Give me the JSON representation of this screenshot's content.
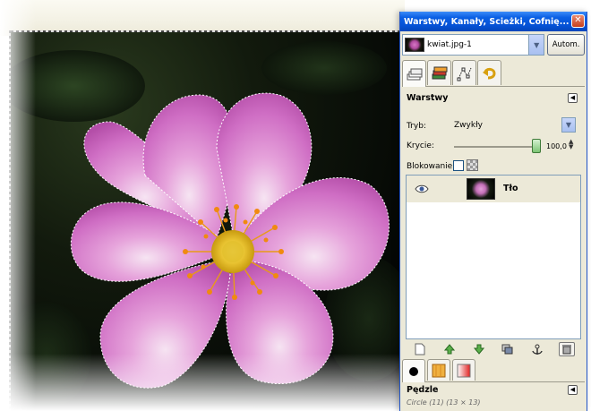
{
  "dock": {
    "title": "Warstwy, Kanały, Ścieżki, Cofnię...",
    "close_icon": "close-icon",
    "image_selector": {
      "value": "kwiat.jpg-1"
    },
    "auto_button": "Autom.",
    "tabs": [
      "layers-tab-icon",
      "channels-tab-icon",
      "paths-tab-icon",
      "undo-tab-icon"
    ]
  },
  "layers_panel": {
    "title": "Warstwy",
    "mode_label": "Tryb:",
    "mode_value": "Zwykły",
    "opacity_label": "Krycie:",
    "opacity_value": "100,0",
    "opacity_level": 1.0,
    "lock_label": "Blokowanie:",
    "layers": [
      {
        "name": "Tło",
        "visible": true
      }
    ],
    "tools": [
      "new-layer-icon",
      "raise-layer-icon",
      "lower-layer-icon",
      "duplicate-layer-icon",
      "anchor-layer-icon",
      "delete-layer-icon"
    ]
  },
  "brushes_panel": {
    "tabs": [
      "brush-tab-icon",
      "pattern-tab-icon",
      "gradient-tab-icon"
    ],
    "title": "Pędzle",
    "subtitle": "Circle (11) (13 × 13)"
  },
  "colors": {
    "titlebar": "#0552d6",
    "petal": "#d47fc9",
    "stamen": "#f0a020",
    "background": "#0a0f08"
  }
}
